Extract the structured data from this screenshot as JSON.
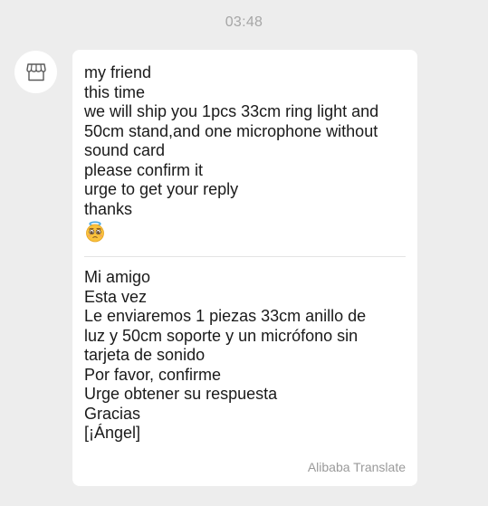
{
  "chat": {
    "timestamp": "03:48"
  },
  "message": {
    "sender_avatar_icon": "shop-storefront-icon",
    "original_lines": [
      "my friend",
      "this time",
      "we will ship you 1pcs 33cm ring light and",
      "50cm stand,and one microphone without",
      "sound card",
      "please confirm it",
      "urge to get your reply",
      "thanks"
    ],
    "emoji_icon": "pleading-angel-emoji-icon",
    "translated_lines": [
      "Mi amigo",
      "Esta vez",
      "Le enviaremos 1 piezas 33cm anillo de",
      "luz y 50cm soporte y un micrófono sin",
      "tarjeta de sonido",
      "Por favor, confirme",
      "Urge obtener su respuesta",
      "Gracias",
      "[¡Ángel]"
    ],
    "translation_credit": "Alibaba Translate"
  }
}
